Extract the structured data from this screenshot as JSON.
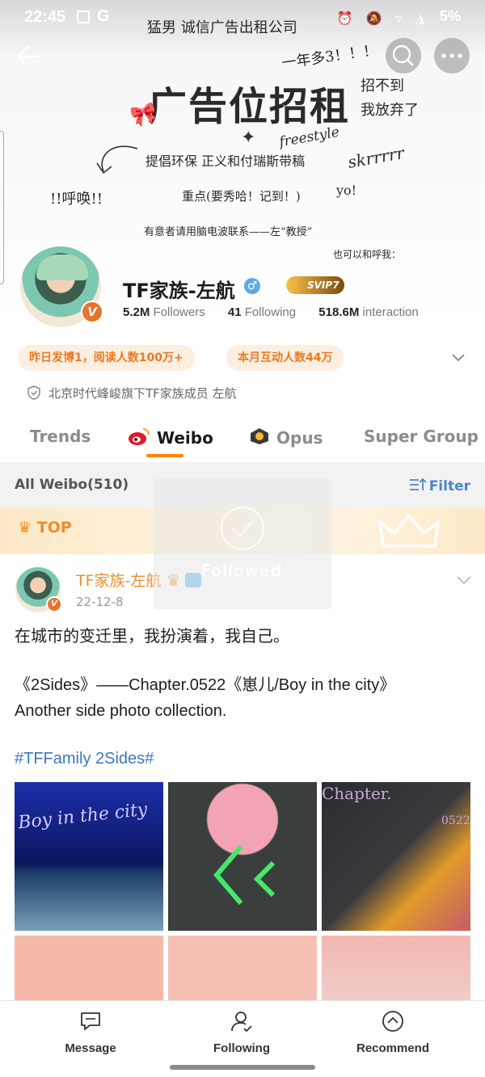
{
  "status_bar": {
    "time": "22:45",
    "g_icon": "G",
    "icons": "⏰ 🔕 ▿ ◮",
    "battery": "5%"
  },
  "banner": {
    "top_line": "猛男 诚信广告出租公司",
    "title": "广告位招租",
    "year": "一年多3！！！",
    "right1": "招不到",
    "right2": "我放弃了",
    "mid": "提倡环保 正义和付瑞斯带稿",
    "freestyle": "freestyle",
    "skr": "skrrrrr",
    "call": "!!呼唤!!",
    "key": "重点(要秀哈！记到！)",
    "yo": "yo!",
    "contact": "有意者请用脑电波联系——左“教授”",
    "also": "也可以和呼我："
  },
  "profile": {
    "name": "TF家族-左航",
    "gender_symbol": "♂",
    "vip_label": "SVIP7",
    "v_badge": "V",
    "followers_count": "5.2M",
    "followers_label": "Followers",
    "following_count": "41",
    "following_label": "Following",
    "interaction_count": "518.6M",
    "interaction_label": "interaction",
    "chip1": "昨日发博1，阅读人数100万+",
    "chip2": "本月互动人数44万",
    "verified_text": "北京时代峰峻旗下TF家族成员 左航"
  },
  "tabs": [
    {
      "label": "Trends"
    },
    {
      "label": "Weibo"
    },
    {
      "label": "Opus"
    },
    {
      "label": "Super Group"
    }
  ],
  "filter": {
    "all_label": "All Weibo(510)",
    "filter_label": "Filter"
  },
  "top_label": "TOP",
  "overlay": {
    "followed": "Followed"
  },
  "post": {
    "author": "TF家族-左航",
    "date": "22-12-8",
    "line1": "在城市的变迁里，我扮演着，我自己。",
    "line2": "《2Sides》——Chapter.0522《崽儿/Boy in the city》",
    "line3": "Another side photo collection.",
    "hashtag": "#TFFamily 2Sides#",
    "pic1_text": "Boy in the city",
    "pic3_text": "Chapter.",
    "pic3_num": "0522"
  },
  "bottom_nav": [
    {
      "label": "Message",
      "icon": "message-icon"
    },
    {
      "label": "Following",
      "icon": "following-icon"
    },
    {
      "label": "Recommend",
      "icon": "recommend-icon"
    }
  ],
  "colors": {
    "accent_orange": "#ff8200",
    "link_blue": "#3b76c4",
    "chip_bg": "#fdeee0"
  }
}
